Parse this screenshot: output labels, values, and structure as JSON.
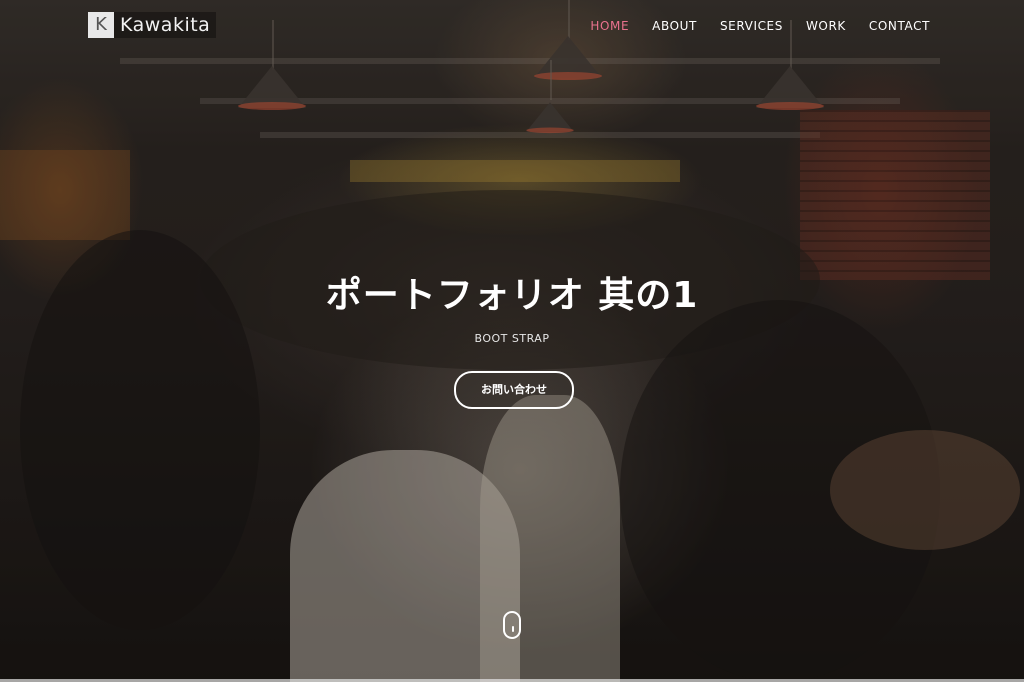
{
  "brand": {
    "mark": "K",
    "name": "Kawakita"
  },
  "nav": {
    "items": [
      {
        "label": "HOME",
        "active": true
      },
      {
        "label": "ABOUT",
        "active": false
      },
      {
        "label": "SERVICES",
        "active": false
      },
      {
        "label": "WORK",
        "active": false
      },
      {
        "label": "CONTACT",
        "active": false
      }
    ],
    "active_color": "#e8718d"
  },
  "hero": {
    "title": "ポートフォリオ 其の1",
    "subtitle": "BOOT STRAP",
    "cta_label": "お問い合わせ",
    "background_image": "group-photo-wedding-party"
  },
  "icons": {
    "scroll": "mouse-scroll-icon"
  }
}
